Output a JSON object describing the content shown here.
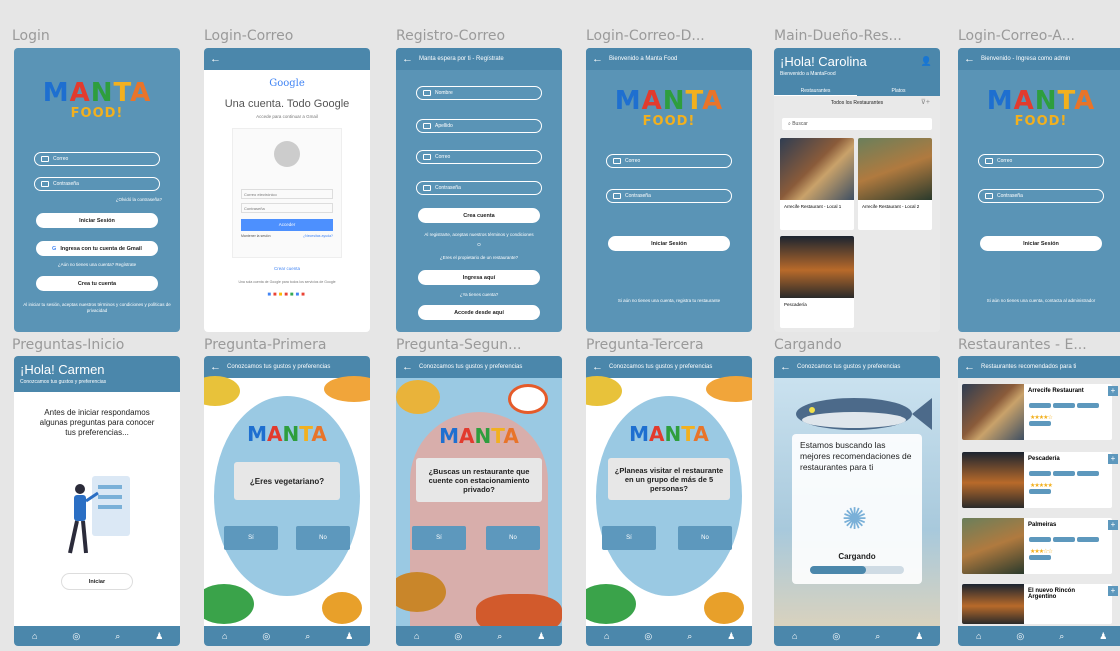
{
  "frames": {
    "login": {
      "title": "Login"
    },
    "login_correo": {
      "title": "Login-Correo"
    },
    "registro_correo": {
      "title": "Registro-Correo"
    },
    "login_correo_d": {
      "title": "Login-Correo-D..."
    },
    "main_dueno": {
      "title": "Main-Dueño-Res..."
    },
    "login_correo_a": {
      "title": "Login-Correo-A..."
    },
    "preguntas_inicio": {
      "title": "Preguntas-Inicio"
    },
    "pregunta_primera": {
      "title": "Pregunta-Primera"
    },
    "pregunta_segunda": {
      "title": "Pregunta-Segun..."
    },
    "pregunta_tercera": {
      "title": "Pregunta-Tercera"
    },
    "cargando": {
      "title": "Cargando"
    },
    "restaurantes": {
      "title": "Restaurantes - E..."
    }
  },
  "logo": {
    "line1": "MANTA",
    "line2": "FOOD!"
  },
  "login": {
    "email_placeholder": "Correo",
    "password_placeholder": "Contraseña",
    "forgot": "¿Olvidó la contraseña?",
    "login_button": "Iniciar Sesión",
    "gmail_button": "Ingresa con tu cuenta de Gmail",
    "no_account": "¿Aún no tienes una cuenta? Regístrate",
    "create_button": "Crea tu cuenta",
    "terms": "Al iniciar tu sesión, aceptas nuestros términos y condiciones y políticas de privacidad"
  },
  "google": {
    "brand": "Google",
    "headline": "Una cuenta. Todo Google",
    "sub": "Accede para continuar a Gmail",
    "email_field": "Correo electrónico",
    "password_field": "Contraseña",
    "signin": "Acceder",
    "remember": "Mantener la sesión",
    "forgot": "¿Necesitas ayuda?",
    "create": "Crear cuenta",
    "footer": "Una sola cuenta de Google para todos los servicios de Google"
  },
  "registro": {
    "header": "Manta espera por ti - Regístrate",
    "name": "Nombre",
    "surname": "Apellido",
    "email": "Correo",
    "password": "Contraseña",
    "create_button": "Crea cuenta",
    "terms": "Al registrarte, aceptas nuestros términos y condiciones",
    "or": "O",
    "owner_q": "¿Eres el propietario de un restaurante?",
    "owner_button": "Ingresa aquí",
    "has_account": "¿Ya tienes cuenta?",
    "login_button": "Accede desde aquí"
  },
  "login_dueno": {
    "header": "Bienvenido a Manta Food",
    "email": "Correo",
    "password": "Contraseña",
    "login_button": "Iniciar Sesión",
    "footer": "Si aún no tienes una cuenta, registra tu restaurante"
  },
  "main_dueno": {
    "greeting": "¡Hola! Carolina",
    "sub": "Bienvenido a MantaFood",
    "tab1": "Restaurantes",
    "tab2": "Platos",
    "filter": "Todos los Restaurantes",
    "search": "Buscar",
    "cards": [
      "Arrecife Restaurant - Local 1",
      "Arrecife Restaurant - Local 2",
      "Pescadería"
    ]
  },
  "login_admin": {
    "header": "Bienvenido - Ingresa como admin",
    "email": "Correo",
    "password": "Contraseña",
    "login_button": "Iniciar Sesión",
    "footer": "Si aún no tienes una cuenta, contacta al administrador"
  },
  "preguntas_inicio": {
    "greeting": "¡Hola! Carmen",
    "sub": "Conozcamos tus gustos y preferencias",
    "body": "Antes de iniciar respondamos algunas preguntas para conocer tus preferencias...",
    "start_button": "Iniciar"
  },
  "questions": {
    "header": "Conozcamos tus gustos y preferencias",
    "logo": "MANTA",
    "q1": "¿Eres vegetariano?",
    "q2": "¿Buscas un restaurante que cuente con estacionamiento privado?",
    "q3": "¿Planeas visitar el restaurante en un grupo de más de 5 personas?",
    "yes": "Sí",
    "no": "No"
  },
  "cargando": {
    "header": "Conozcamos tus gustos y preferencias",
    "text": "Estamos buscando las mejores recomendaciones de restaurantes para ti",
    "loading": "Cargando",
    "progress": 0.6
  },
  "restaurantes": {
    "header": "Restaurantes recomendados para ti",
    "items": [
      {
        "name": "Arrecife Restaurant",
        "stars": "★★★★☆"
      },
      {
        "name": "Pescadería",
        "stars": "★★★★★"
      },
      {
        "name": "Palmeiras",
        "stars": "★★★☆☆"
      },
      {
        "name": "El nuevo Rincón Argentino",
        "stars": ""
      }
    ]
  },
  "nav_icons": [
    "home-icon",
    "compass-icon",
    "search-icon",
    "user-icon"
  ],
  "colors": {
    "primary": "#5a94b6",
    "header": "#4b87ab",
    "background": "#e6e6e6"
  }
}
